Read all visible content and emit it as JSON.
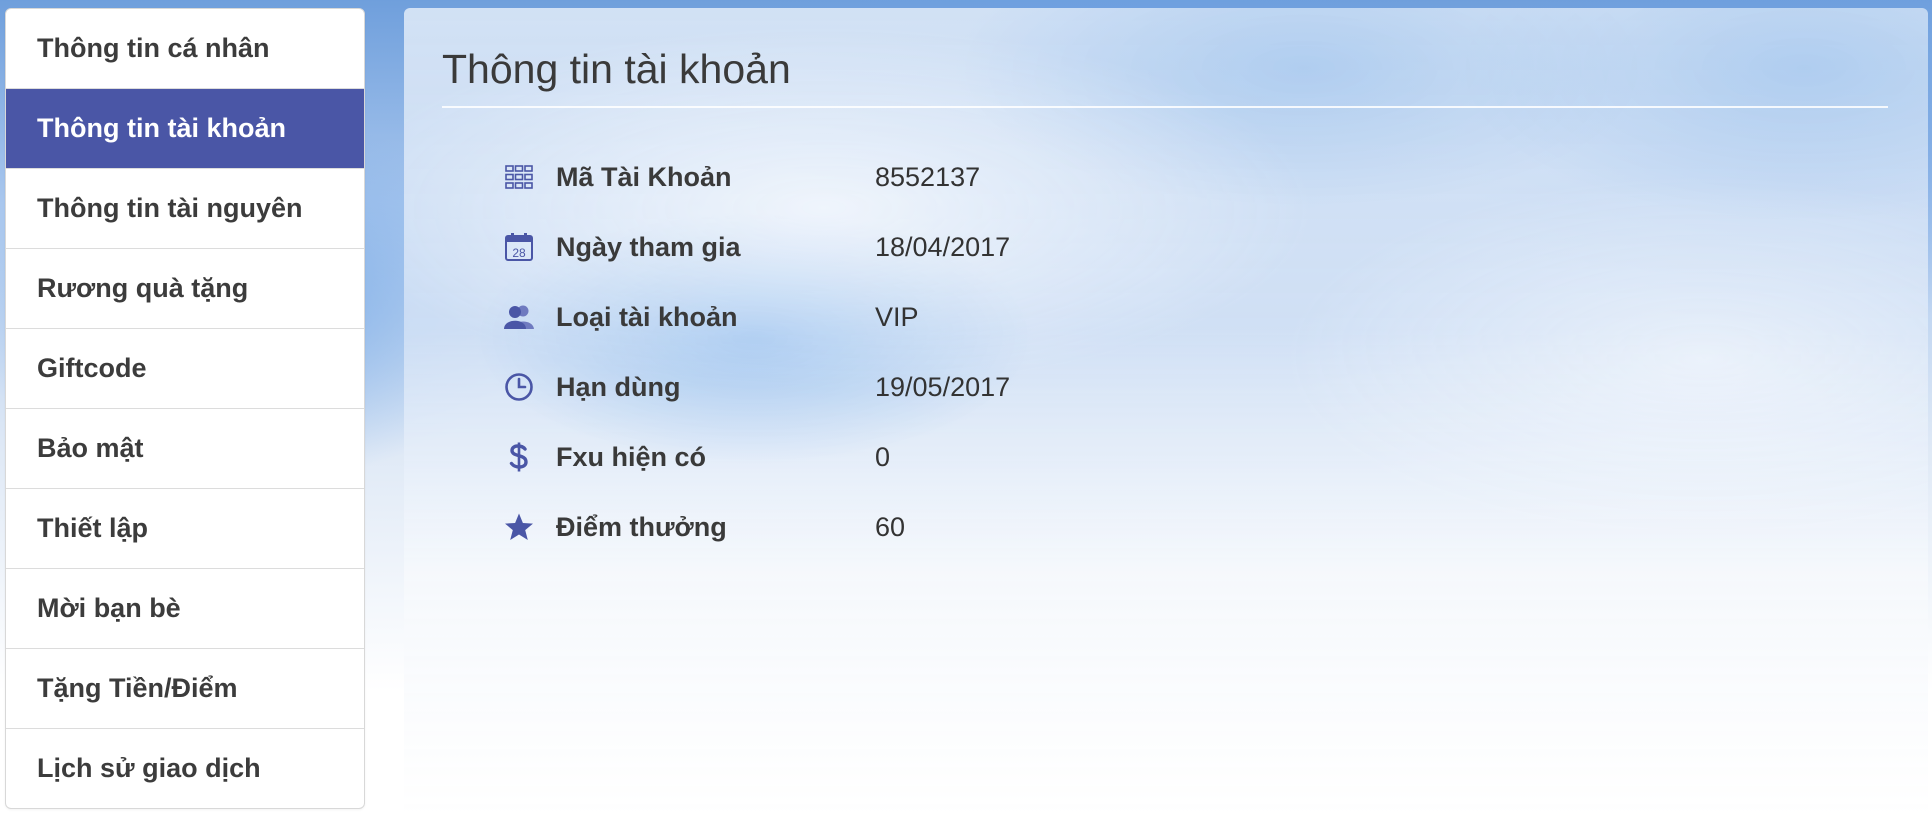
{
  "sidebar": {
    "items": [
      {
        "label": "Thông tin cá nhân"
      },
      {
        "label": "Thông tin tài khoản"
      },
      {
        "label": "Thông tin tài nguyên"
      },
      {
        "label": "Rương quà tặng"
      },
      {
        "label": "Giftcode"
      },
      {
        "label": "Bảo mật"
      },
      {
        "label": "Thiết lập"
      },
      {
        "label": "Mời bạn bè"
      },
      {
        "label": "Tặng Tiền/Điểm"
      },
      {
        "label": "Lịch sử giao dịch"
      }
    ],
    "active_label": "Thông tin tài khoản"
  },
  "main": {
    "title": "Thông tin tài khoản",
    "rows": [
      {
        "icon": "grid-icon",
        "label": "Mã Tài Khoản",
        "value": "8552137"
      },
      {
        "icon": "calendar-icon",
        "label": "Ngày tham gia",
        "value": "18/04/2017"
      },
      {
        "icon": "users-icon",
        "label": "Loại tài khoản",
        "value": "VIP"
      },
      {
        "icon": "clock-icon",
        "label": "Hạn dùng",
        "value": "19/05/2017"
      },
      {
        "icon": "dollar-icon",
        "label": "Fxu hiện có",
        "value": "0"
      },
      {
        "icon": "star-icon",
        "label": "Điểm thưởng",
        "value": "60"
      }
    ],
    "calendar_icon_day": "28"
  },
  "colors": {
    "accent": "#4a56a6",
    "icon": "#4a56a6",
    "text": "#3a3a3a"
  }
}
